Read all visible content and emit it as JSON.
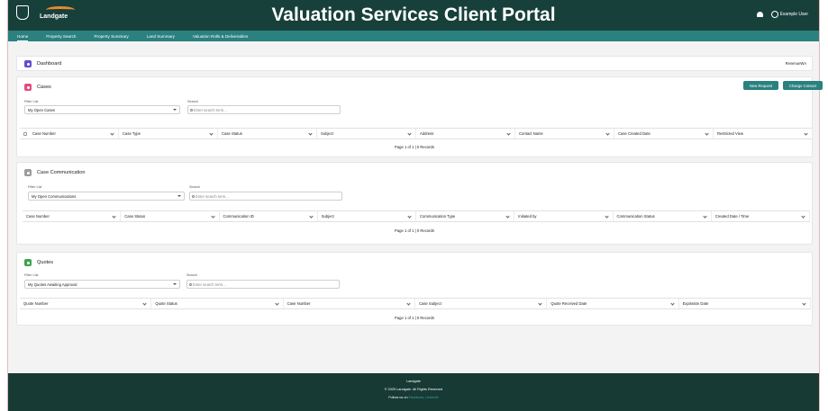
{
  "header": {
    "brand": "Landgate",
    "title": "Valuation Services Client Portal",
    "user": "Example User"
  },
  "nav": [
    "Home",
    "Property Search",
    "Property Summary",
    "Land Summary",
    "Valuation Rolls & Deliverables"
  ],
  "dashboard": {
    "title": "Dashboard",
    "right_label": "RevenueWA"
  },
  "cases": {
    "title": "Cases",
    "filter_label": "Filter List",
    "filter_value": "My Open Cases",
    "search_label": "Search",
    "search_placeholder": "Enter search term...",
    "buttons": [
      "New Request",
      "Change Contact"
    ],
    "columns": [
      "Case Number",
      "Case Type",
      "Case Status",
      "Subject",
      "Address",
      "Contact Name",
      "Case Created Date",
      "Restricted View"
    ],
    "pager": "Page 1 of 1 | 0 Records"
  },
  "communication": {
    "title": "Case Communication",
    "filter_label": "Filter List",
    "filter_value": "My Open Communications",
    "search_label": "Search",
    "search_placeholder": "Enter search term...",
    "columns": [
      "Case Number",
      "Case Status",
      "Communication ID",
      "Subject",
      "Communication Type",
      "Initiated by",
      "Communication Status",
      "Created Date / Time"
    ],
    "pager": "Page 1 of 1 | 0 Records"
  },
  "quotes": {
    "title": "Quotes",
    "filter_label": "Filter List",
    "filter_value": "My Quotes Awaiting Approval",
    "search_label": "Search",
    "search_placeholder": "Enter search term...",
    "columns": [
      "Quote Number",
      "Quote Status",
      "Case Number",
      "Case Subject",
      "Quote Received Date",
      "Expiration Date"
    ],
    "pager": "Page 1 of 1 | 0 Records"
  },
  "footer": {
    "line1": "Landgate",
    "line2": "© 2025 Landgate. All Rights Reserved",
    "line3_prefix": "Follow us on ",
    "line3_links": "Facebook, LinkedIn"
  },
  "colors": {
    "header": "#17403a",
    "nav": "#2b8080",
    "cases_icon": "#e64b7f",
    "comm_icon": "#9b9b9b",
    "quotes_icon": "#3ea34a",
    "dashboard_icon": "#5d4fd1"
  }
}
